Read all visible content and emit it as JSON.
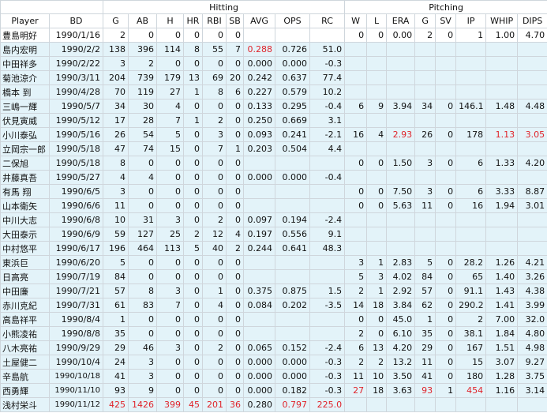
{
  "header": {
    "groups": {
      "hitting": "Hitting",
      "pitching": "Pitching"
    },
    "columns": [
      "Player",
      "BD",
      "G",
      "AB",
      "H",
      "HR",
      "RBI",
      "SB",
      "AVG",
      "OPS",
      "RC",
      "W",
      "L",
      "ERA",
      "G",
      "SV",
      "IP",
      "WHIP",
      "DIPS"
    ]
  },
  "colors": {
    "highlight": "#e0242b",
    "row_bg": "#e3f3f9"
  },
  "rows": [
    {
      "player": "豊島明好",
      "bd": "1990/1/16",
      "g": "2",
      "ab": "0",
      "h": "0",
      "hr": "0",
      "rbi": "0",
      "sb": "0",
      "avg": "",
      "ops": "",
      "rc": "",
      "w": "0",
      "l": "0",
      "era": "0.00",
      "pg": "2",
      "sv": "0",
      "ip": "1",
      "whip": "1.00",
      "dips": "4.70"
    },
    {
      "player": "島内宏明",
      "bd": "1990/2/2",
      "g": "138",
      "ab": "396",
      "h": "114",
      "hr": "8",
      "rbi": "55",
      "sb": "7",
      "avg": "0.288",
      "ops": "0.726",
      "rc": "51.0",
      "w": "",
      "l": "",
      "era": "",
      "pg": "",
      "sv": "",
      "ip": "",
      "whip": "",
      "dips": ""
    },
    {
      "player": "中田祥多",
      "bd": "1990/2/22",
      "g": "3",
      "ab": "2",
      "h": "0",
      "hr": "0",
      "rbi": "0",
      "sb": "0",
      "avg": "0.000",
      "ops": "0.000",
      "rc": "-0.3",
      "w": "",
      "l": "",
      "era": "",
      "pg": "",
      "sv": "",
      "ip": "",
      "whip": "",
      "dips": ""
    },
    {
      "player": "菊池涼介",
      "bd": "1990/3/11",
      "g": "204",
      "ab": "739",
      "h": "179",
      "hr": "13",
      "rbi": "69",
      "sb": "20",
      "avg": "0.242",
      "ops": "0.637",
      "rc": "77.4",
      "w": "",
      "l": "",
      "era": "",
      "pg": "",
      "sv": "",
      "ip": "",
      "whip": "",
      "dips": ""
    },
    {
      "player": "橋本 到",
      "bd": "1990/4/28",
      "g": "70",
      "ab": "119",
      "h": "27",
      "hr": "1",
      "rbi": "8",
      "sb": "6",
      "avg": "0.227",
      "ops": "0.579",
      "rc": "10.2",
      "w": "",
      "l": "",
      "era": "",
      "pg": "",
      "sv": "",
      "ip": "",
      "whip": "",
      "dips": ""
    },
    {
      "player": "三嶋一輝",
      "bd": "1990/5/7",
      "g": "34",
      "ab": "30",
      "h": "4",
      "hr": "0",
      "rbi": "0",
      "sb": "0",
      "avg": "0.133",
      "ops": "0.295",
      "rc": "-0.4",
      "w": "6",
      "l": "9",
      "era": "3.94",
      "pg": "34",
      "sv": "0",
      "ip": "146.1",
      "whip": "1.48",
      "dips": "4.48"
    },
    {
      "player": "伏見寅威",
      "bd": "1990/5/12",
      "g": "17",
      "ab": "28",
      "h": "7",
      "hr": "1",
      "rbi": "2",
      "sb": "0",
      "avg": "0.250",
      "ops": "0.669",
      "rc": "3.1",
      "w": "",
      "l": "",
      "era": "",
      "pg": "",
      "sv": "",
      "ip": "",
      "whip": "",
      "dips": ""
    },
    {
      "player": "小川泰弘",
      "bd": "1990/5/16",
      "g": "26",
      "ab": "54",
      "h": "5",
      "hr": "0",
      "rbi": "3",
      "sb": "0",
      "avg": "0.093",
      "ops": "0.241",
      "rc": "-2.1",
      "w": "16",
      "l": "4",
      "era": "2.93",
      "pg": "26",
      "sv": "0",
      "ip": "178",
      "whip": "1.13",
      "dips": "3.05"
    },
    {
      "player": "立岡宗一郎",
      "bd": "1990/5/18",
      "g": "47",
      "ab": "74",
      "h": "15",
      "hr": "0",
      "rbi": "7",
      "sb": "1",
      "avg": "0.203",
      "ops": "0.504",
      "rc": "4.4",
      "w": "",
      "l": "",
      "era": "",
      "pg": "",
      "sv": "",
      "ip": "",
      "whip": "",
      "dips": ""
    },
    {
      "player": "二保旭",
      "bd": "1990/5/18",
      "g": "8",
      "ab": "0",
      "h": "0",
      "hr": "0",
      "rbi": "0",
      "sb": "0",
      "avg": "",
      "ops": "",
      "rc": "",
      "w": "0",
      "l": "0",
      "era": "1.50",
      "pg": "3",
      "sv": "0",
      "ip": "6",
      "whip": "1.33",
      "dips": "4.20"
    },
    {
      "player": "井藤真吾",
      "bd": "1990/5/27",
      "g": "4",
      "ab": "4",
      "h": "0",
      "hr": "0",
      "rbi": "0",
      "sb": "0",
      "avg": "0.000",
      "ops": "0.000",
      "rc": "-0.4",
      "w": "",
      "l": "",
      "era": "",
      "pg": "",
      "sv": "",
      "ip": "",
      "whip": "",
      "dips": ""
    },
    {
      "player": "有馬 翔",
      "bd": "1990/6/5",
      "g": "3",
      "ab": "0",
      "h": "0",
      "hr": "0",
      "rbi": "0",
      "sb": "0",
      "avg": "",
      "ops": "",
      "rc": "",
      "w": "0",
      "l": "0",
      "era": "7.50",
      "pg": "3",
      "sv": "0",
      "ip": "6",
      "whip": "3.33",
      "dips": "8.87"
    },
    {
      "player": "山本衛矢",
      "bd": "1990/6/6",
      "g": "11",
      "ab": "0",
      "h": "0",
      "hr": "0",
      "rbi": "0",
      "sb": "0",
      "avg": "",
      "ops": "",
      "rc": "",
      "w": "0",
      "l": "0",
      "era": "5.63",
      "pg": "11",
      "sv": "0",
      "ip": "16",
      "whip": "1.94",
      "dips": "3.01"
    },
    {
      "player": "中川大志",
      "bd": "1990/6/8",
      "g": "10",
      "ab": "31",
      "h": "3",
      "hr": "0",
      "rbi": "2",
      "sb": "0",
      "avg": "0.097",
      "ops": "0.194",
      "rc": "-2.4",
      "w": "",
      "l": "",
      "era": "",
      "pg": "",
      "sv": "",
      "ip": "",
      "whip": "",
      "dips": ""
    },
    {
      "player": "大田泰示",
      "bd": "1990/6/9",
      "g": "59",
      "ab": "127",
      "h": "25",
      "hr": "2",
      "rbi": "12",
      "sb": "4",
      "avg": "0.197",
      "ops": "0.556",
      "rc": "9.1",
      "w": "",
      "l": "",
      "era": "",
      "pg": "",
      "sv": "",
      "ip": "",
      "whip": "",
      "dips": ""
    },
    {
      "player": "中村悠平",
      "bd": "1990/6/17",
      "g": "196",
      "ab": "464",
      "h": "113",
      "hr": "5",
      "rbi": "40",
      "sb": "2",
      "avg": "0.244",
      "ops": "0.641",
      "rc": "48.3",
      "w": "",
      "l": "",
      "era": "",
      "pg": "",
      "sv": "",
      "ip": "",
      "whip": "",
      "dips": ""
    },
    {
      "player": "東浜巨",
      "bd": "1990/6/20",
      "g": "5",
      "ab": "0",
      "h": "0",
      "hr": "0",
      "rbi": "0",
      "sb": "0",
      "avg": "",
      "ops": "",
      "rc": "",
      "w": "3",
      "l": "1",
      "era": "2.83",
      "pg": "5",
      "sv": "0",
      "ip": "28.2",
      "whip": "1.26",
      "dips": "4.21"
    },
    {
      "player": "日高亮",
      "bd": "1990/7/19",
      "g": "84",
      "ab": "0",
      "h": "0",
      "hr": "0",
      "rbi": "0",
      "sb": "0",
      "avg": "",
      "ops": "",
      "rc": "",
      "w": "5",
      "l": "3",
      "era": "4.02",
      "pg": "84",
      "sv": "0",
      "ip": "65",
      "whip": "1.40",
      "dips": "3.26"
    },
    {
      "player": "中田廉",
      "bd": "1990/7/21",
      "g": "57",
      "ab": "8",
      "h": "3",
      "hr": "0",
      "rbi": "1",
      "sb": "0",
      "avg": "0.375",
      "ops": "0.875",
      "rc": "1.5",
      "w": "2",
      "l": "1",
      "era": "2.92",
      "pg": "57",
      "sv": "0",
      "ip": "91.1",
      "whip": "1.43",
      "dips": "4.38"
    },
    {
      "player": "赤川克紀",
      "bd": "1990/7/31",
      "g": "61",
      "ab": "83",
      "h": "7",
      "hr": "0",
      "rbi": "4",
      "sb": "0",
      "avg": "0.084",
      "ops": "0.202",
      "rc": "-3.5",
      "w": "14",
      "l": "18",
      "era": "3.84",
      "pg": "62",
      "sv": "0",
      "ip": "290.2",
      "whip": "1.41",
      "dips": "3.99"
    },
    {
      "player": "高島祥平",
      "bd": "1990/8/4",
      "g": "1",
      "ab": "0",
      "h": "0",
      "hr": "0",
      "rbi": "0",
      "sb": "0",
      "avg": "",
      "ops": "",
      "rc": "",
      "w": "0",
      "l": "0",
      "era": "45.0",
      "pg": "1",
      "sv": "0",
      "ip": "2",
      "whip": "7.00",
      "dips": "32.0"
    },
    {
      "player": "小熊凌祐",
      "bd": "1990/8/8",
      "g": "35",
      "ab": "0",
      "h": "0",
      "hr": "0",
      "rbi": "0",
      "sb": "0",
      "avg": "",
      "ops": "",
      "rc": "",
      "w": "2",
      "l": "0",
      "era": "6.10",
      "pg": "35",
      "sv": "0",
      "ip": "38.1",
      "whip": "1.84",
      "dips": "4.80"
    },
    {
      "player": "八木亮祐",
      "bd": "1990/9/29",
      "g": "29",
      "ab": "46",
      "h": "3",
      "hr": "0",
      "rbi": "2",
      "sb": "0",
      "avg": "0.065",
      "ops": "0.152",
      "rc": "-2.4",
      "w": "6",
      "l": "13",
      "era": "4.20",
      "pg": "29",
      "sv": "0",
      "ip": "167",
      "whip": "1.51",
      "dips": "4.98"
    },
    {
      "player": "土屋健二",
      "bd": "1990/10/4",
      "g": "24",
      "ab": "3",
      "h": "0",
      "hr": "0",
      "rbi": "0",
      "sb": "0",
      "avg": "0.000",
      "ops": "0.000",
      "rc": "-0.3",
      "w": "2",
      "l": "2",
      "era": "13.2",
      "pg": "11",
      "sv": "0",
      "ip": "15",
      "whip": "3.07",
      "dips": "9.27"
    },
    {
      "player": "辛島航",
      "bd": "1990/10/18",
      "g": "41",
      "ab": "3",
      "h": "0",
      "hr": "0",
      "rbi": "0",
      "sb": "0",
      "avg": "0.000",
      "ops": "0.000",
      "rc": "-0.3",
      "w": "11",
      "l": "10",
      "era": "3.50",
      "pg": "41",
      "sv": "0",
      "ip": "180",
      "whip": "1.28",
      "dips": "3.75"
    },
    {
      "player": "西勇輝",
      "bd": "1990/11/10",
      "g": "93",
      "ab": "9",
      "h": "0",
      "hr": "0",
      "rbi": "0",
      "sb": "0",
      "avg": "0.000",
      "ops": "0.182",
      "rc": "-0.3",
      "w": "27",
      "l": "18",
      "era": "3.63",
      "pg": "93",
      "sv": "1",
      "ip": "454",
      "whip": "1.16",
      "dips": "3.14"
    },
    {
      "player": "浅村栄斗",
      "bd": "1990/11/12",
      "g": "425",
      "ab": "1426",
      "h": "399",
      "hr": "45",
      "rbi": "201",
      "sb": "36",
      "avg": "0.280",
      "ops": "0.797",
      "rc": "225.0",
      "w": "",
      "l": "",
      "era": "",
      "pg": "",
      "sv": "",
      "ip": "",
      "whip": "",
      "dips": ""
    }
  ],
  "red_cells": {
    "1": [
      "avg"
    ],
    "7": [
      "era",
      "whip",
      "dips"
    ],
    "25": [
      "w",
      "pg",
      "ip"
    ],
    "26": [
      "g",
      "ab",
      "h",
      "hr",
      "rbi",
      "sb",
      "ops",
      "rc"
    ]
  },
  "small_bd_rows": [
    24,
    25,
    26
  ]
}
